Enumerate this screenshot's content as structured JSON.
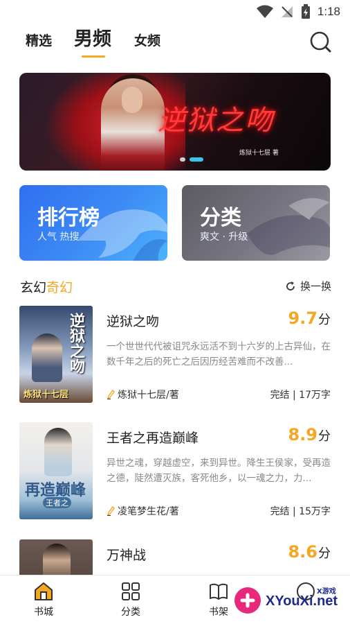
{
  "status_bar": {
    "time": "1:18"
  },
  "top_tabs": [
    {
      "label": "精选",
      "active": false
    },
    {
      "label": "男频",
      "active": true
    },
    {
      "label": "女频",
      "active": false
    }
  ],
  "banner": {
    "title": "逆狱之吻",
    "author": "炼狱十七层 著",
    "slides": 2,
    "active_slide": 2
  },
  "cards": {
    "rank": {
      "title": "排行榜",
      "subtitle": "人气  热搜"
    },
    "category": {
      "title": "分类",
      "subtitle": "爽文 · 升级"
    }
  },
  "section": {
    "title_part1": "玄幻",
    "title_part2": "奇幻",
    "refresh_label": "换一换"
  },
  "books": [
    {
      "title": "逆狱之吻",
      "score": "9.7",
      "score_unit": "分",
      "desc": "一个世世代代被诅咒永远活不到十六岁的上古异仙，在数千年之后的死亡之后因历经苦难而不改善...",
      "author": "炼狱十七层/著",
      "meta": "完结 | 17万字",
      "cover_title": "逆狱之吻",
      "cover_author": "炼狱十七层"
    },
    {
      "title": "王者之再造巅峰",
      "score": "8.9",
      "score_unit": "分",
      "desc": "异世之魂，穿越虚空，来到异世。降生王侯家，受再造之德，陡然遭灭族，客死他乡，以一魂之力，力...",
      "author": "凌笔梦生花/著",
      "meta": "完结 | 15万字",
      "cover_title": "再造巅峰",
      "cover_author": "王者之"
    },
    {
      "title": "万神战",
      "score": "8.6",
      "score_unit": "分"
    }
  ],
  "bottom_nav": [
    {
      "label": "书城",
      "active": true
    },
    {
      "label": "分类",
      "active": false
    },
    {
      "label": "书架",
      "active": false
    }
  ],
  "watermark": {
    "text": "XYouXi.net",
    "small": "X游戏"
  },
  "colors": {
    "accent": "#f5a623",
    "banner_dot_active": "#37c6e8",
    "rank_card": "#3d8bf4",
    "category_card": "#77757f"
  }
}
